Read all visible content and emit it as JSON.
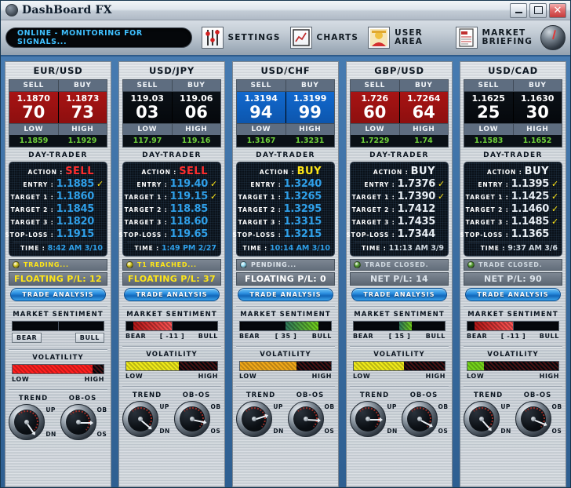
{
  "window": {
    "title": "DashBoard FX",
    "app_icon": "compass-icon",
    "minimize_label": "_",
    "maximize_label": "□",
    "close_label": "✕"
  },
  "toolbar": {
    "status_text": "ONLINE - MONITORING FOR SIGNALS...",
    "items": [
      {
        "label": "SETTINGS",
        "icon": "sliders-icon"
      },
      {
        "label": "CHARTS",
        "icon": "line-chart-icon"
      },
      {
        "label": "USER AREA",
        "icon": "user-icon"
      },
      {
        "label": "MARKET\nBRIEFING",
        "icon": "document-icon"
      }
    ],
    "compass_icon": "compass-gauge-icon"
  },
  "labels": {
    "sell": "SELL",
    "buy": "BUY",
    "low": "LOW",
    "high": "HIGH",
    "day_trader": "DAY-TRADER",
    "action": "ACTION :",
    "entry": "ENTRY :",
    "target1": "TARGET 1 :",
    "target2": "TARGET 2 :",
    "target3": "TARGET 3 :",
    "stoploss": "STOP-LOSS :",
    "time": "TIME :",
    "trade_analysis": "TRADE ANALYSIS",
    "market_sentiment": "MARKET SENTIMENT",
    "volatility": "VOLATILITY",
    "bear": "BEAR",
    "bull": "BULL",
    "vol_low": "LOW",
    "vol_high": "HIGH",
    "trend": "TREND",
    "obos": "OB-OS",
    "up": "UP",
    "dn": "DN",
    "ob": "OB",
    "os": "OS",
    "check": "✓"
  },
  "colors": {
    "red_quote": "#a81414",
    "blue_quote": "#1169cf",
    "dark_quote": "#0a1119",
    "green_text": "#6fd13a",
    "cyan_value": "#2f9fe8",
    "yellow": "#ffe617",
    "red_action": "#ff2d2d"
  },
  "panels": [
    {
      "pair": "EUR/USD",
      "quote_style": "red",
      "sell_small": "1.1870",
      "sell_big": "70",
      "buy_small": "1.1873",
      "buy_big": "73",
      "low": "1.1859",
      "high": "1.1929",
      "trade": {
        "action": "SELL",
        "action_style": "sell",
        "value_style": "cyan",
        "entry": "1.1885",
        "entry_check": true,
        "target1": "1.1860",
        "target1_check": false,
        "target2": "1.1845",
        "target2_check": false,
        "target3": "1.1820",
        "target3_check": false,
        "stoploss": "1.1915",
        "time": "8:42 AM 3/10",
        "status_text": "TRADING...",
        "status_color": "#ffe617",
        "status_dot": "#d2c41a",
        "pl_text": "FLOATING P/L: 12",
        "pl_color": "#ffe617"
      },
      "sentiment": {
        "value": null,
        "value_label": null,
        "show_buttons": true,
        "fill_pct": 0,
        "direction": "none",
        "color": "#b51717"
      },
      "volatility": {
        "pct": 88,
        "color": "#ff1f1f"
      },
      "trend_angle": 55,
      "obos_angle": 0
    },
    {
      "pair": "USD/JPY",
      "quote_style": "dark",
      "sell_small": "119.03",
      "sell_big": "03",
      "buy_small": "119.06",
      "buy_big": "06",
      "low": "117.97",
      "high": "119.16",
      "trade": {
        "action": "SELL",
        "action_style": "sell",
        "value_style": "cyan",
        "entry": "119.40",
        "entry_check": true,
        "target1": "119.15",
        "target1_check": true,
        "target2": "118.85",
        "target2_check": false,
        "target3": "118.60",
        "target3_check": false,
        "stoploss": "119.65",
        "time": "1:49 PM 2/27",
        "status_text": "T1 REACHED...",
        "status_color": "#ffe617",
        "status_dot": "#d2c41a",
        "pl_text": "FLOATING P/L: 37",
        "pl_color": "#ffe617"
      },
      "sentiment": {
        "value": -11,
        "value_label": "[ -11 ]",
        "show_buttons": false,
        "fill_pct": 42,
        "direction": "bear",
        "color": "#b51717"
      },
      "volatility": {
        "pct": 58,
        "color": "#f0ea1a"
      },
      "trend_angle": 40,
      "obos_angle": 12
    },
    {
      "pair": "USD/CHF",
      "quote_style": "blue",
      "sell_small": "1.3194",
      "sell_big": "94",
      "buy_small": "1.3199",
      "buy_big": "99",
      "low": "1.3167",
      "high": "1.3231",
      "trade": {
        "action": "BUY",
        "action_style": "buy",
        "value_style": "cyan",
        "entry": "1.3240",
        "entry_check": false,
        "target1": "1.3265",
        "target1_check": false,
        "target2": "1.3295",
        "target2_check": false,
        "target3": "1.3315",
        "target3_check": false,
        "stoploss": "1.3215",
        "time": "10:14 AM 3/10",
        "status_text": "PENDING...",
        "status_color": "#dde4eb",
        "status_dot": "#8fd8f0",
        "pl_text": "FLOATING P/L: 0",
        "pl_color": "#ffffff"
      },
      "sentiment": {
        "value": 35,
        "value_label": "[ 35 ]",
        "show_buttons": false,
        "fill_pct": 36,
        "direction": "bull",
        "color": "#74d419"
      },
      "volatility": {
        "pct": 62,
        "color": "#f0a81a"
      },
      "trend_angle": -18,
      "obos_angle": 3
    },
    {
      "pair": "GBP/USD",
      "quote_style": "red",
      "sell_small": "1.726",
      "sell_big": "60",
      "buy_small": "1.7264",
      "buy_big": "64",
      "low": "1.7229",
      "high": "1.74",
      "trade": {
        "action": "BUY",
        "action_style": "buy-white",
        "value_style": "white",
        "entry": "1.7376",
        "entry_check": true,
        "target1": "1.7390",
        "target1_check": true,
        "target2": "1.7412",
        "target2_check": false,
        "target3": "1.7435",
        "target3_check": false,
        "stoploss": "1.7344",
        "time": "11:13 AM 3/9",
        "status_text": "TRADE CLOSED.",
        "status_color": "#cfd8e0",
        "status_dot": "#4f9b2a",
        "pl_text": "NET P/L: 14",
        "pl_color": "#dde4eb"
      },
      "sentiment": {
        "value": 15,
        "value_label": "[ 15 ]",
        "show_buttons": false,
        "fill_pct": 14,
        "direction": "bull",
        "color": "#74d419"
      },
      "volatility": {
        "pct": 55,
        "color": "#f0ea1a"
      },
      "trend_angle": 0,
      "obos_angle": 28
    },
    {
      "pair": "USD/CAD",
      "quote_style": "dark",
      "sell_small": "1.1625",
      "sell_big": "25",
      "buy_small": "1.1630",
      "buy_big": "30",
      "low": "1.1583",
      "high": "1.1652",
      "trade": {
        "action": "BUY",
        "action_style": "buy-white",
        "value_style": "white",
        "entry": "1.1395",
        "entry_check": true,
        "target1": "1.1425",
        "target1_check": true,
        "target2": "1.1460",
        "target2_check": true,
        "target3": "1.1485",
        "target3_check": true,
        "stoploss": "1.1365",
        "time": "9:37 AM 3/6",
        "status_text": "TRADE CLOSED.",
        "status_color": "#cfd8e0",
        "status_dot": "#4f9b2a",
        "pl_text": "NET P/L: 90",
        "pl_color": "#dde4eb"
      },
      "sentiment": {
        "value": -11,
        "value_label": "[ -11 ]",
        "show_buttons": false,
        "fill_pct": 42,
        "direction": "bear",
        "color": "#b51717"
      },
      "volatility": {
        "pct": 18,
        "color": "#74d419"
      },
      "trend_angle": 48,
      "obos_angle": 22
    }
  ]
}
